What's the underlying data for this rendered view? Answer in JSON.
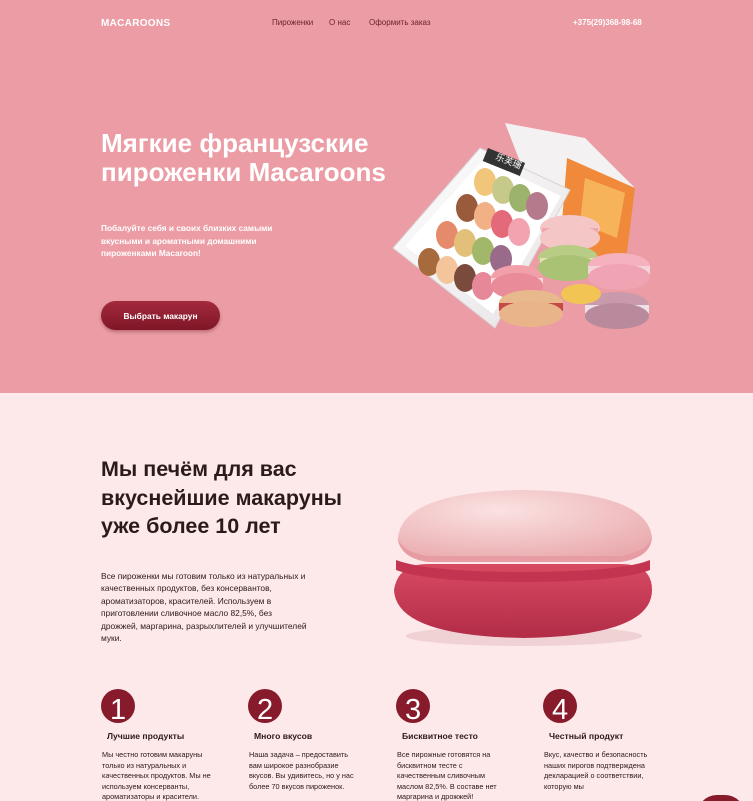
{
  "nav": {
    "logo": "MACAROONS",
    "links": [
      "Пироженки",
      "О нас",
      "Оформить заказ"
    ],
    "phone": "+375(29)368-98-68"
  },
  "hero": {
    "title": "Мягкие французские пироженки Macaroons",
    "subtitle": "Побалуйте себя и своих близких самыми вкусными и ароматными домашними пироженками Macaroon!",
    "button": "Выбрать макарун",
    "box_label": "乐芙珊",
    "bg_color": "#eb9ca4"
  },
  "about": {
    "title": "Мы печём для вас вкуснейшие макаруны уже более 10 лет",
    "text": "Все пироженки мы готовим только из натуральных и качественных продуктов, без консервантов, ароматизаторов, красителей. Используем в приготовлении сливочное масло 82,5%, без дрожжей, маргарина, разрыхлителей и улучшителей муки."
  },
  "features": [
    {
      "num": "1",
      "title": "Лучшие продукты",
      "text": "Мы честно готовим макаруны только из натуральных и качественных продуктов. Мы не используем консерванты, ароматизаторы и красители."
    },
    {
      "num": "2",
      "title": "Много вкусов",
      "text": "Наша задача – предоставить вам широкое разнобразие вкусов. Вы удивитесь, но у нас более 70 вкусов пироженок."
    },
    {
      "num": "3",
      "title": "Бисквитное тесто",
      "text": "Все пирожные готовятся на бисквитном тесте с качественным сливочным маслом 82,5%. В составе нет маргарина и дрожжей!"
    },
    {
      "num": "4",
      "title": "Честный продукт",
      "text": "Вкус, качество и безопасность наших пирогов подтверждена декларацией о соответствии, которую мы"
    }
  ],
  "colors": {
    "accent": "#871a2b",
    "hero_bg": "#eb9ca4",
    "page_bg": "#fde9ea"
  }
}
